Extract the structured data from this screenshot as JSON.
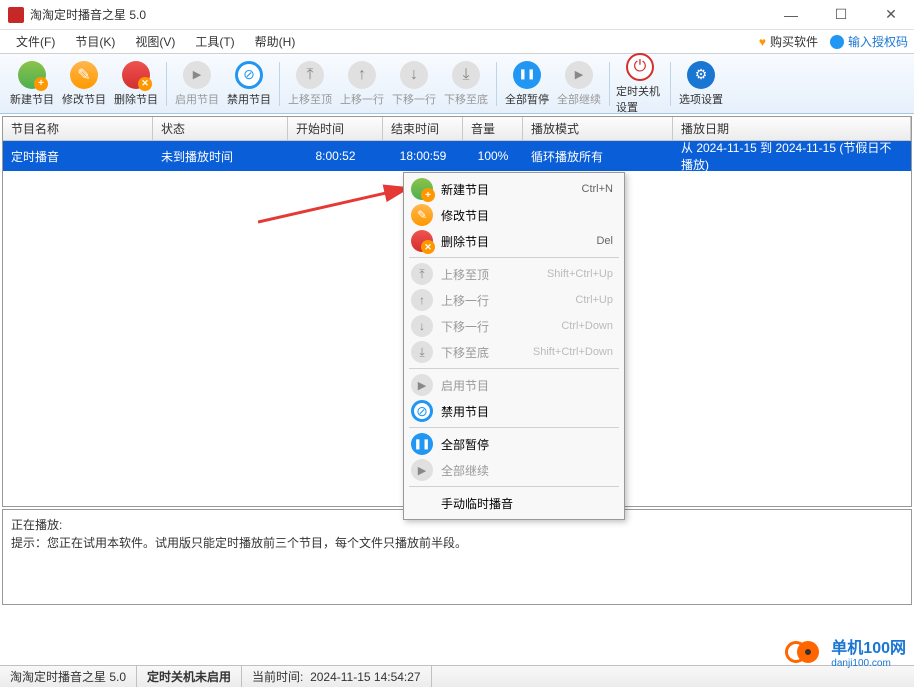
{
  "window": {
    "title": "淘淘定时播音之星 5.0"
  },
  "menubar": {
    "items": [
      "文件(F)",
      "节目(K)",
      "视图(V)",
      "工具(T)",
      "帮助(H)"
    ],
    "buy": "购买软件",
    "auth": "输入授权码"
  },
  "toolbar": {
    "new": "新建节目",
    "edit": "修改节目",
    "delete": "删除节目",
    "enable": "启用节目",
    "disable": "禁用节目",
    "moveTop": "上移至顶",
    "moveUp": "上移一行",
    "moveDown": "下移一行",
    "moveBottom": "下移至底",
    "pauseAll": "全部暂停",
    "resumeAll": "全部继续",
    "shutdown": "定时关机设置",
    "settings": "选项设置"
  },
  "table": {
    "headers": {
      "name": "节目名称",
      "status": "状态",
      "start": "开始时间",
      "end": "结束时间",
      "vol": "音量",
      "mode": "播放模式",
      "date": "播放日期"
    },
    "rows": [
      {
        "name": "定时播音",
        "status": "未到播放时间",
        "start": "8:00:52",
        "end": "18:00:59",
        "vol": "100%",
        "mode": "循环播放所有",
        "date": "从 2024-11-15 到 2024-11-15 (节假日不播放)"
      }
    ]
  },
  "context_menu": {
    "new": {
      "label": "新建节目",
      "shortcut": "Ctrl+N"
    },
    "edit": {
      "label": "修改节目",
      "shortcut": ""
    },
    "delete": {
      "label": "删除节目",
      "shortcut": "Del"
    },
    "moveTop": {
      "label": "上移至顶",
      "shortcut": "Shift+Ctrl+Up"
    },
    "moveUp": {
      "label": "上移一行",
      "shortcut": "Ctrl+Up"
    },
    "moveDown": {
      "label": "下移一行",
      "shortcut": "Ctrl+Down"
    },
    "moveBottom": {
      "label": "下移至底",
      "shortcut": "Shift+Ctrl+Down"
    },
    "enable": {
      "label": "启用节目",
      "shortcut": ""
    },
    "disable": {
      "label": "禁用节目",
      "shortcut": ""
    },
    "pauseAll": {
      "label": "全部暂停",
      "shortcut": ""
    },
    "resumeAll": {
      "label": "全部继续",
      "shortcut": ""
    },
    "manual": {
      "label": "手动临时播音",
      "shortcut": ""
    }
  },
  "status_panel": {
    "line1": "正在播放:",
    "line2": "提示：您正在试用本软件。试用版只能定时播放前三个节目，每个文件只播放前半段。"
  },
  "statusbar": {
    "app": "淘淘定时播音之星 5.0",
    "shutdown": "定时关机未启用",
    "time_label": "当前时间:",
    "time_value": "2024-11-15 14:54:27"
  },
  "watermark": {
    "text": "单机100网",
    "sub": "danji100.com"
  }
}
